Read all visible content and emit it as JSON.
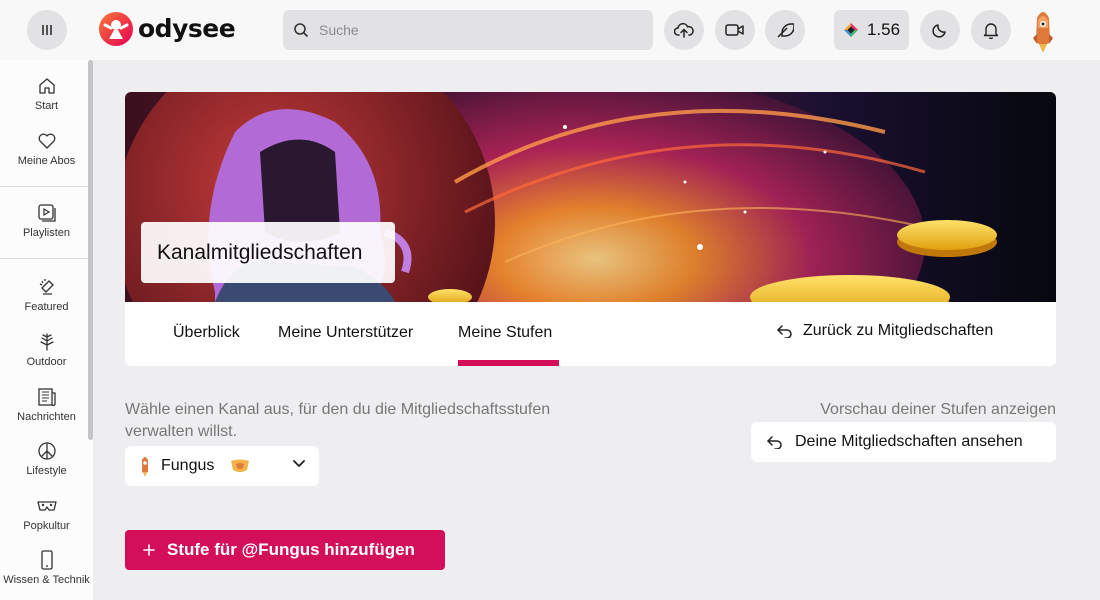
{
  "header": {
    "logo_text": "odysee",
    "search": {
      "placeholder": "Suche",
      "value": ""
    },
    "wallet_balance": "1.56"
  },
  "sidebar": {
    "items": [
      {
        "label": "Start",
        "icon": "home-icon"
      },
      {
        "label": "Meine Abos",
        "icon": "heart-icon"
      },
      {
        "label": "Playlisten",
        "icon": "playlist-icon"
      },
      {
        "label": "Featured",
        "icon": "featured-icon"
      },
      {
        "label": "Outdoor",
        "icon": "tree-icon"
      },
      {
        "label": "Nachrichten",
        "icon": "newspaper-icon"
      },
      {
        "label": "Lifestyle",
        "icon": "peace-icon"
      },
      {
        "label": "Popkultur",
        "icon": "mask-icon"
      },
      {
        "label": "Wissen & Technik",
        "icon": "phone-icon"
      }
    ]
  },
  "banner": {
    "title": "Kanalmitgliedschaften"
  },
  "tabs": [
    {
      "label": "Überblick",
      "active": false
    },
    {
      "label": "Meine Unterstützer",
      "active": false
    },
    {
      "label": "Meine Stufen",
      "active": true
    }
  ],
  "back_link": "Zurück zu Mitgliedschaften",
  "tiers": {
    "description": "Wähle einen Kanal aus, für den du die Mitgliedschaftsstufen verwalten willst.",
    "preview_label": "Vorschau deiner Stufen anzeigen",
    "view_memberships_button": "Deine Mitgliedschaften ansehen",
    "channel": {
      "name": "Fungus"
    },
    "add_tier_button": "Stufe für @Fungus hinzufügen"
  },
  "colors": {
    "accent": "#d40f5a",
    "background": "#eeeef0"
  }
}
